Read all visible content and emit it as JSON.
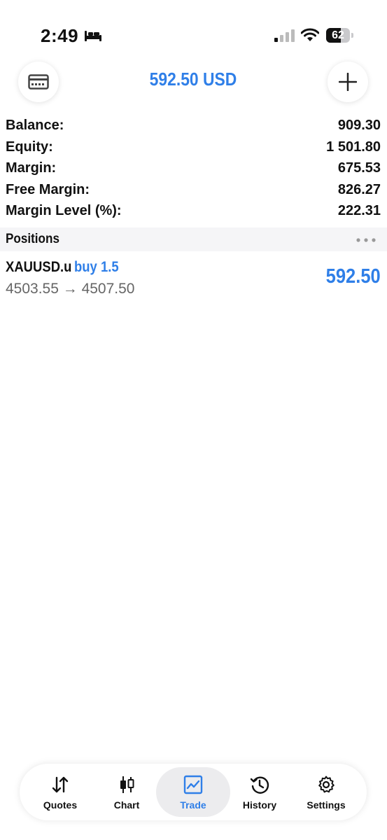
{
  "status_bar": {
    "time": "2:49",
    "battery_level": "62",
    "battery_fraction": 0.62,
    "icons": [
      "bed-icon",
      "cellular-signal-icon",
      "wifi-icon",
      "battery-icon"
    ]
  },
  "header": {
    "title": "592.50 USD",
    "left_icon": "card-icon",
    "right_icon": "plus-icon"
  },
  "summary": {
    "rows": [
      {
        "label": "Balance:",
        "value": "909.30"
      },
      {
        "label": "Equity:",
        "value": "1 501.80"
      },
      {
        "label": "Margin:",
        "value": "675.53"
      },
      {
        "label": "Free Margin:",
        "value": "826.27"
      },
      {
        "label": "Margin Level (%):",
        "value": "222.31"
      }
    ]
  },
  "positions": {
    "title": "Positions",
    "items": [
      {
        "symbol": "XAUUSD.u",
        "direction": "buy 1.5",
        "prices": "4503.55 → 4507.50",
        "profit": "592.50"
      }
    ]
  },
  "tabbar": {
    "tabs": [
      {
        "label": "Quotes",
        "icon": "quotes-arrows-icon"
      },
      {
        "label": "Chart",
        "icon": "candlestick-icon"
      },
      {
        "label": "Trade",
        "icon": "trade-chart-icon",
        "active": true
      },
      {
        "label": "History",
        "icon": "history-icon"
      },
      {
        "label": "Settings",
        "icon": "gear-icon"
      }
    ]
  },
  "colors": {
    "accent": "#2f7fe8",
    "text": "#111111",
    "muted": "#666666",
    "section_bg": "#f5f5f7"
  }
}
